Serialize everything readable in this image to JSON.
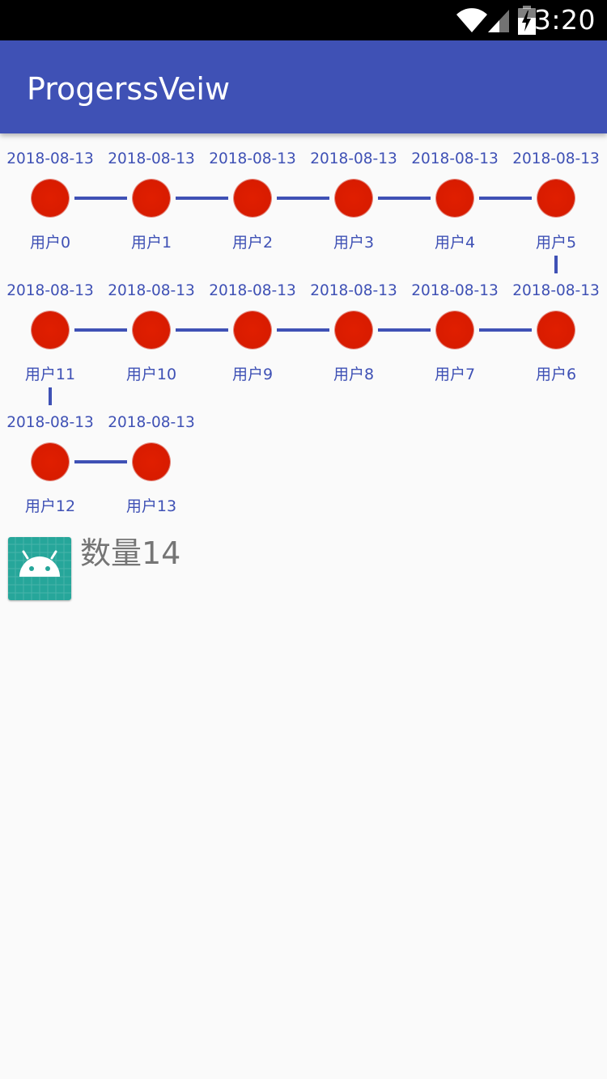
{
  "status_bar": {
    "time": "3:20",
    "icons": [
      "wifi-icon",
      "cellular-signal-icon",
      "battery-charging-icon"
    ]
  },
  "app_bar": {
    "title": "ProgerssVeiw"
  },
  "timeline": {
    "nodes": [
      {
        "date": "2018-08-13",
        "user": "用户0"
      },
      {
        "date": "2018-08-13",
        "user": "用户1"
      },
      {
        "date": "2018-08-13",
        "user": "用户2"
      },
      {
        "date": "2018-08-13",
        "user": "用户3"
      },
      {
        "date": "2018-08-13",
        "user": "用户4"
      },
      {
        "date": "2018-08-13",
        "user": "用户5"
      },
      {
        "date": "2018-08-13",
        "user": "用户6"
      },
      {
        "date": "2018-08-13",
        "user": "用户7"
      },
      {
        "date": "2018-08-13",
        "user": "用户8"
      },
      {
        "date": "2018-08-13",
        "user": "用户9"
      },
      {
        "date": "2018-08-13",
        "user": "用户10"
      },
      {
        "date": "2018-08-13",
        "user": "用户11"
      },
      {
        "date": "2018-08-13",
        "user": "用户12"
      },
      {
        "date": "2018-08-13",
        "user": "用户13"
      }
    ]
  },
  "summary": {
    "icon": "android-app-icon",
    "count_text": "数量14"
  },
  "colors": {
    "status_bar": "#000000",
    "app_bar": "#3f51b5",
    "accent_text": "#3f51b5",
    "node_dot": "#d91c00",
    "connector": "#3f51b5",
    "background": "#fafafa",
    "count_text": "#757575",
    "app_icon_bg": "#26a69a"
  }
}
